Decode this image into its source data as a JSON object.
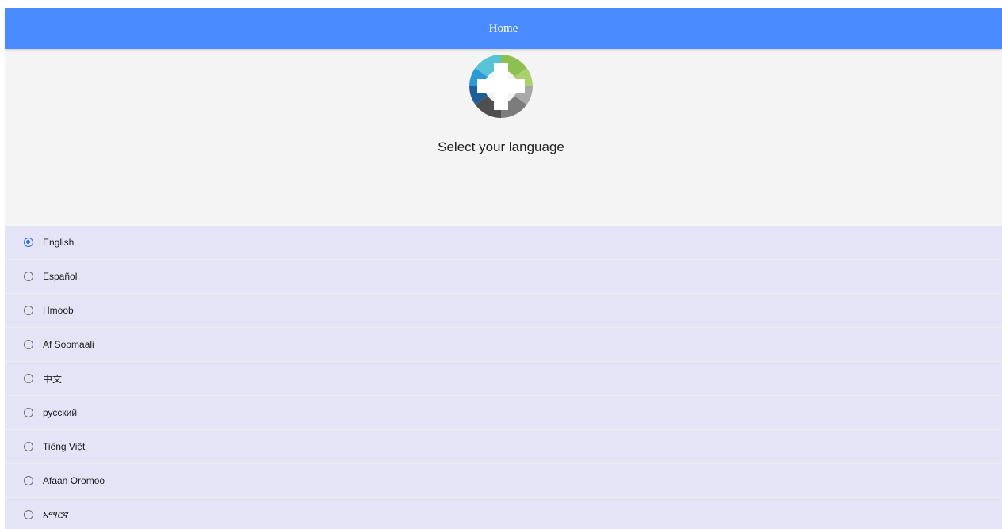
{
  "header": {
    "title": "Home",
    "bg_color": "#4a8cff"
  },
  "hero": {
    "logo_icon": "cross-medical-logo",
    "prompt": "Select your language"
  },
  "languages": {
    "selected_index": 0,
    "items": [
      {
        "label": "English",
        "selected": true
      },
      {
        "label": "Español",
        "selected": false
      },
      {
        "label": "Hmoob",
        "selected": false
      },
      {
        "label": "Af Soomaali",
        "selected": false
      },
      {
        "label": "中文",
        "selected": false
      },
      {
        "label": "русский",
        "selected": false
      },
      {
        "label": "Tiếng Việt",
        "selected": false
      },
      {
        "label": "Afaan Oromoo",
        "selected": false
      },
      {
        "label": "አማርኛ",
        "selected": false
      }
    ]
  },
  "colors": {
    "list_bg": "#e4e4f6",
    "hero_bg": "#f4f4f4",
    "radio_selected": "#2f6fde"
  }
}
